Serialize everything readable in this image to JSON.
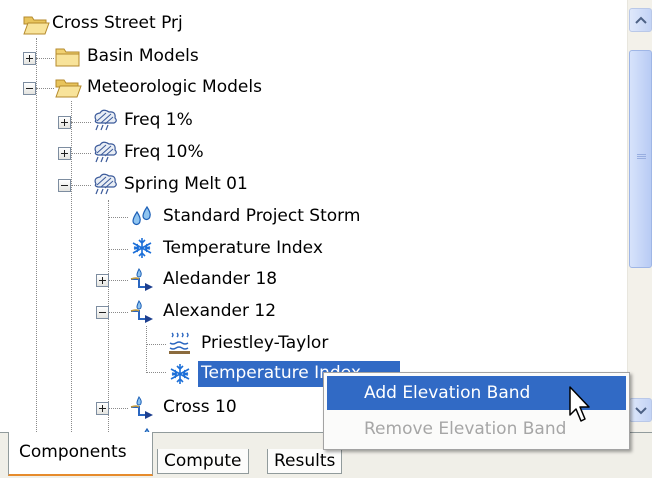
{
  "tree": {
    "root": "Cross Street Prj",
    "items": [
      {
        "label": "Basin Models",
        "icon": "folder-icon"
      },
      {
        "label": "Meteorologic Models",
        "icon": "folder-open-icon"
      },
      {
        "label": "Freq 1%",
        "icon": "storm-icon"
      },
      {
        "label": "Freq 10%",
        "icon": "storm-icon"
      },
      {
        "label": "Spring Melt 01",
        "icon": "storm-icon"
      },
      {
        "label": "Standard Project Storm",
        "icon": "water-drops-icon"
      },
      {
        "label": "Temperature Index",
        "icon": "snowflake-icon"
      },
      {
        "label": "Aledander 18",
        "icon": "subbasin-icon"
      },
      {
        "label": "Alexander 12",
        "icon": "subbasin-icon"
      },
      {
        "label": "Priestley-Taylor",
        "icon": "evapotranspiration-icon"
      },
      {
        "label": "Temperature Index",
        "icon": "snowflake-icon"
      },
      {
        "label": "Cross 10",
        "icon": "subbasin-icon"
      }
    ]
  },
  "context_menu": {
    "items": [
      {
        "label": "Add Elevation Band",
        "state": "highlighted"
      },
      {
        "label": "Remove Elevation Band",
        "state": "disabled"
      }
    ]
  },
  "tabs": [
    {
      "label": "Components",
      "active": true
    },
    {
      "label": "Compute",
      "active": false
    },
    {
      "label": "Results",
      "active": false
    }
  ],
  "colors": {
    "selection": "#316ac5",
    "folder": "#f4d66b",
    "active_tab_accent": "#e68b2c",
    "disabled_text": "#a6a6a6"
  }
}
